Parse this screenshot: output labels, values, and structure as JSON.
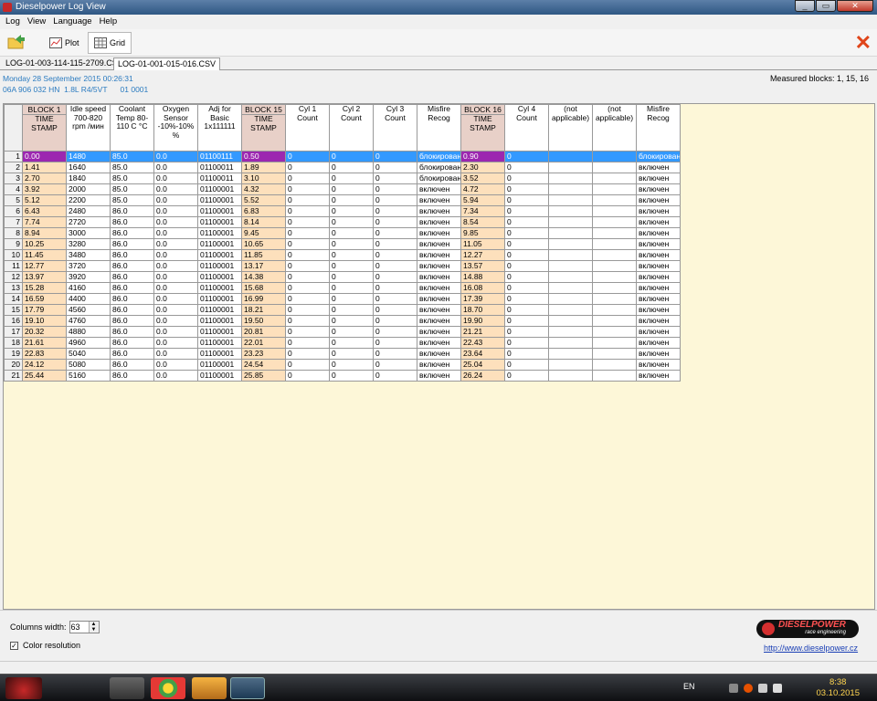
{
  "window": {
    "title": "Dieselpower Log View"
  },
  "menu": [
    "Log",
    "View",
    "Language",
    "Help"
  ],
  "toolbar": {
    "plot_label": "Plot",
    "grid_label": "Grid"
  },
  "tabs": [
    "LOG-01-003-114-115-2709.CSV",
    "LOG-01-001-015-016.CSV"
  ],
  "info": {
    "date_line": "Monday 28 September 2015 00:26:31",
    "ecu_line": "06A 906 032 HN  1.8L R4/5VT      01 0001",
    "measured": "Measured blocks: 1, 15, 16"
  },
  "grid": {
    "block_labels": [
      "BLOCK 1",
      "BLOCK 15",
      "BLOCK 16"
    ],
    "headers": [
      "TIME STAMP",
      "Idle speed 700-820 rpm /мин",
      "Coolant Temp 80-110 C °C",
      "Oxygen Sensor -10%-10% %",
      "Adj for Basic 1x111111",
      "TIME STAMP",
      "Cyl 1 Count",
      "Cyl 2 Count",
      "Cyl 3 Count",
      "Misfire Recog",
      "TIME STAMP",
      "Cyl 4 Count",
      "(not applicable)",
      "(not applicable)",
      "Misfire Recog"
    ],
    "selected_row": 1,
    "rows": [
      [
        "1",
        "0.00",
        "1480",
        "85.0",
        "0.0",
        "01100111",
        "0.50",
        "0",
        "0",
        "0",
        "блокирован",
        "0.90",
        "0",
        "",
        "",
        "блокирован"
      ],
      [
        "2",
        "1.41",
        "1640",
        "85.0",
        "0.0",
        "01100011",
        "1.89",
        "0",
        "0",
        "0",
        "блокирован",
        "2.30",
        "0",
        "",
        "",
        "включен"
      ],
      [
        "3",
        "2.70",
        "1840",
        "85.0",
        "0.0",
        "01100011",
        "3.10",
        "0",
        "0",
        "0",
        "блокирован",
        "3.52",
        "0",
        "",
        "",
        "включен"
      ],
      [
        "4",
        "3.92",
        "2000",
        "85.0",
        "0.0",
        "01100001",
        "4.32",
        "0",
        "0",
        "0",
        "включен",
        "4.72",
        "0",
        "",
        "",
        "включен"
      ],
      [
        "5",
        "5.12",
        "2200",
        "85.0",
        "0.0",
        "01100001",
        "5.52",
        "0",
        "0",
        "0",
        "включен",
        "5.94",
        "0",
        "",
        "",
        "включен"
      ],
      [
        "6",
        "6.43",
        "2480",
        "86.0",
        "0.0",
        "01100001",
        "6.83",
        "0",
        "0",
        "0",
        "включен",
        "7.34",
        "0",
        "",
        "",
        "включен"
      ],
      [
        "7",
        "7.74",
        "2720",
        "86.0",
        "0.0",
        "01100001",
        "8.14",
        "0",
        "0",
        "0",
        "включен",
        "8.54",
        "0",
        "",
        "",
        "включен"
      ],
      [
        "8",
        "8.94",
        "3000",
        "86.0",
        "0.0",
        "01100001",
        "9.45",
        "0",
        "0",
        "0",
        "включен",
        "9.85",
        "0",
        "",
        "",
        "включен"
      ],
      [
        "9",
        "10.25",
        "3280",
        "86.0",
        "0.0",
        "01100001",
        "10.65",
        "0",
        "0",
        "0",
        "включен",
        "11.05",
        "0",
        "",
        "",
        "включен"
      ],
      [
        "10",
        "11.45",
        "3480",
        "86.0",
        "0.0",
        "01100001",
        "11.85",
        "0",
        "0",
        "0",
        "включен",
        "12.27",
        "0",
        "",
        "",
        "включен"
      ],
      [
        "11",
        "12.77",
        "3720",
        "86.0",
        "0.0",
        "01100001",
        "13.17",
        "0",
        "0",
        "0",
        "включен",
        "13.57",
        "0",
        "",
        "",
        "включен"
      ],
      [
        "12",
        "13.97",
        "3920",
        "86.0",
        "0.0",
        "01100001",
        "14.38",
        "0",
        "0",
        "0",
        "включен",
        "14.88",
        "0",
        "",
        "",
        "включен"
      ],
      [
        "13",
        "15.28",
        "4160",
        "86.0",
        "0.0",
        "01100001",
        "15.68",
        "0",
        "0",
        "0",
        "включен",
        "16.08",
        "0",
        "",
        "",
        "включен"
      ],
      [
        "14",
        "16.59",
        "4400",
        "86.0",
        "0.0",
        "01100001",
        "16.99",
        "0",
        "0",
        "0",
        "включен",
        "17.39",
        "0",
        "",
        "",
        "включен"
      ],
      [
        "15",
        "17.79",
        "4560",
        "86.0",
        "0.0",
        "01100001",
        "18.21",
        "0",
        "0",
        "0",
        "включен",
        "18.70",
        "0",
        "",
        "",
        "включен"
      ],
      [
        "16",
        "19.10",
        "4760",
        "86.0",
        "0.0",
        "01100001",
        "19.50",
        "0",
        "0",
        "0",
        "включен",
        "19.90",
        "0",
        "",
        "",
        "включен"
      ],
      [
        "17",
        "20.32",
        "4880",
        "86.0",
        "0.0",
        "01100001",
        "20.81",
        "0",
        "0",
        "0",
        "включен",
        "21.21",
        "0",
        "",
        "",
        "включен"
      ],
      [
        "18",
        "21.61",
        "4960",
        "86.0",
        "0.0",
        "01100001",
        "22.01",
        "0",
        "0",
        "0",
        "включен",
        "22.43",
        "0",
        "",
        "",
        "включен"
      ],
      [
        "19",
        "22.83",
        "5040",
        "86.0",
        "0.0",
        "01100001",
        "23.23",
        "0",
        "0",
        "0",
        "включен",
        "23.64",
        "0",
        "",
        "",
        "включен"
      ],
      [
        "20",
        "24.12",
        "5080",
        "86.0",
        "0.0",
        "01100001",
        "24.54",
        "0",
        "0",
        "0",
        "включен",
        "25.04",
        "0",
        "",
        "",
        "включен"
      ],
      [
        "21",
        "25.44",
        "5160",
        "86.0",
        "0.0",
        "01100001",
        "25.85",
        "0",
        "0",
        "0",
        "включен",
        "26.24",
        "0",
        "",
        "",
        "включен"
      ]
    ]
  },
  "bottom": {
    "columns_width_label": "Columns width:",
    "columns_width_value": "63",
    "color_resolution_label": "Color resolution",
    "logo_text": "DIESELPOWER",
    "logo_sub": "race engineering",
    "link": "http://www.dieselpower.cz"
  },
  "taskbar": {
    "lang": "EN",
    "time": "8:38",
    "date": "03.10.2015"
  }
}
